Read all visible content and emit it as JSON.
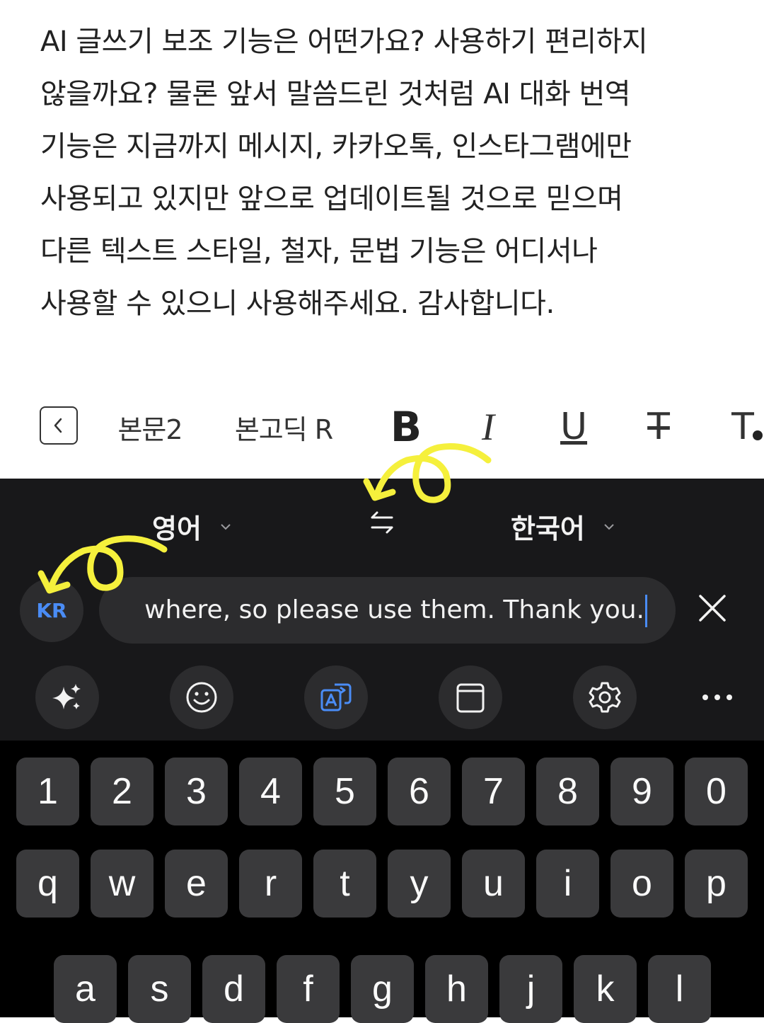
{
  "document": {
    "lines": [
      "AI 글쓰기 보조 기능은 어떤가요? 사용하기 편리하지",
      "않을까요? 물론 앞서 말씀드린 것처럼 AI 대화 번역",
      "기능은 지금까지 메시지, 카카오톡, 인스타그램에만",
      "사용되고 있지만 앞으로 업데이트될 것으로 믿으며",
      "다른 텍스트 스타일, 철자, 문법 기능은 어디서나",
      "사용할 수 있으니 사용해주세요. 감사합니다."
    ]
  },
  "format_toolbar": {
    "back_icon": "chevron-left-icon",
    "paragraph_style": "본문2",
    "font_name": "본고딕 R",
    "bold": "B",
    "italic": "I",
    "underline": "U",
    "strikethrough": "T",
    "text_color": "T"
  },
  "translator": {
    "source_language": "영어",
    "target_language": "한국어",
    "input_language_badge": "KR",
    "translated_text": "where, so please use them. Thank you.",
    "clear_icon": "close-icon"
  },
  "tools": [
    "sparkle-icon",
    "emoji-icon",
    "translate-icon",
    "clipboard-icon",
    "settings-icon",
    "more-icon"
  ],
  "keyboard": {
    "number_row": [
      "1",
      "2",
      "3",
      "4",
      "5",
      "6",
      "7",
      "8",
      "9",
      "0"
    ],
    "top_row": [
      "q",
      "w",
      "e",
      "r",
      "t",
      "y",
      "u",
      "i",
      "o",
      "p"
    ],
    "home_row": [
      "a",
      "s",
      "d",
      "f",
      "g",
      "h",
      "j",
      "k",
      "l"
    ]
  },
  "colors": {
    "keyboard_bg": "#18181a",
    "key_bg": "#3a3a3c",
    "accent_blue": "#4a8cf5",
    "annotation_yellow": "#f5f03c"
  }
}
